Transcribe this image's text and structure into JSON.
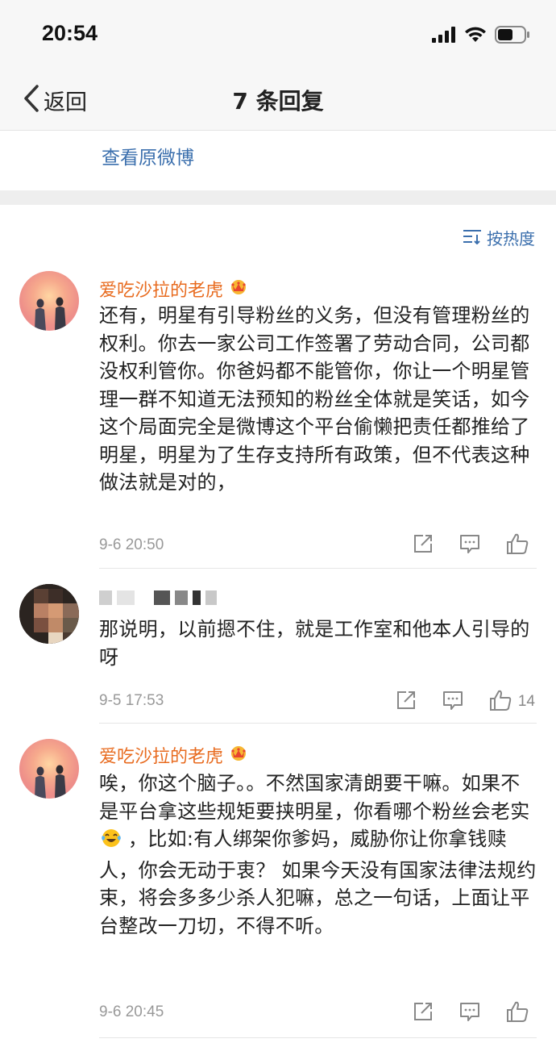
{
  "status_bar": {
    "time": "20:54"
  },
  "nav": {
    "back_label": "返回",
    "title": "7 条回复"
  },
  "original_link": "查看原微博",
  "sort": {
    "label": "按热度"
  },
  "comments": [
    {
      "username": "爱吃沙拉的老虎",
      "text": "还有，明星有引导粉丝的义务，但没有管理粉丝的权利。你去一家公司工作签署了劳动合同，公司都没权利管你。你爸妈都不能管你，你让一个明星管理一群不知道无法预知的粉丝全体就是笑话，如今这个局面完全是微博这个平台偷懒把责任都推给了明星，明星为了生存支持所有政策，但不代表这种做法就是对的，",
      "time": "9-6 20:50",
      "likes": ""
    },
    {
      "username": "",
      "text": "那说明，以前摁不住，就是工作室和他本人引导的呀",
      "time": "9-5 17:53",
      "likes": "14"
    },
    {
      "username": "爱吃沙拉的老虎",
      "text_part1": "唉，你这个脑子。。不然国家清朗要干嘛。如果不是平台拿这些规矩要挟明星，你看哪个粉丝会老实",
      "text_part2": " ，比如:有人绑架你爹妈，威胁你让你拿钱赎人，你会无动于衷？ 如果今天没有国家法律法规约束，将会多多少杀人犯嘛，总之一句话，上面让平台整改一刀切，不得不听。",
      "time": "9-6 20:45",
      "likes": ""
    }
  ],
  "icons": {
    "back": "chevron-left-icon",
    "sort": "sort-icon",
    "share": "share-icon",
    "comment": "comment-icon",
    "like": "like-icon",
    "badge": "crown-badge-icon",
    "emoji": "tears-of-joy-emoji"
  },
  "colors": {
    "username": "#e86b1f",
    "link": "#3b6fad",
    "meta": "#999999"
  }
}
